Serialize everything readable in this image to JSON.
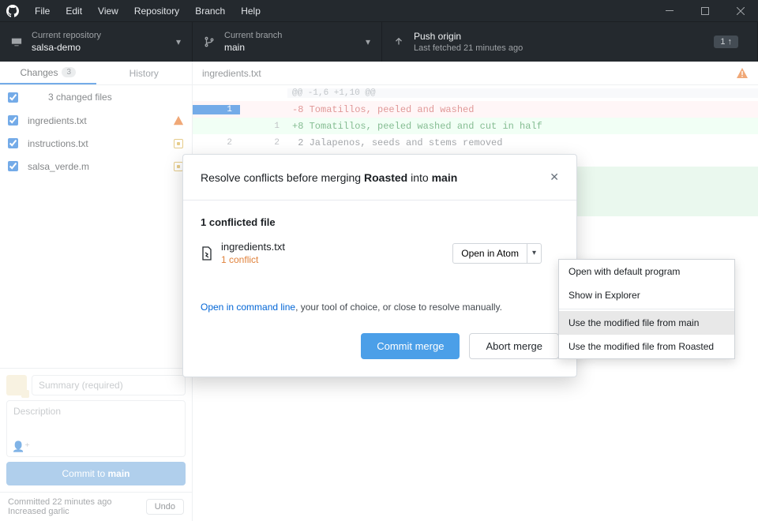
{
  "menubar": {
    "items": [
      "File",
      "Edit",
      "View",
      "Repository",
      "Branch",
      "Help"
    ]
  },
  "toolbar": {
    "repo": {
      "label": "Current repository",
      "value": "salsa-demo"
    },
    "branch": {
      "label": "Current branch",
      "value": "main"
    },
    "push": {
      "label": "Push origin",
      "value": "Last fetched 21 minutes ago",
      "badge": "1 ↑"
    }
  },
  "tabs": {
    "changes": {
      "label": "Changes",
      "count": "3"
    },
    "history": {
      "label": "History"
    }
  },
  "filelist": {
    "header": "3 changed files",
    "files": [
      {
        "name": "ingredients.txt",
        "status": "conflict"
      },
      {
        "name": "instructions.txt",
        "status": "modified"
      },
      {
        "name": "salsa_verde.m",
        "status": "modified"
      }
    ]
  },
  "commit_form": {
    "summary_placeholder": "Summary (required)",
    "description_placeholder": "Description",
    "button_prefix": "Commit to ",
    "button_branch": "main"
  },
  "statusbar": {
    "line1": "Committed 22 minutes ago",
    "line2": "Increased garlic",
    "undo": "Undo"
  },
  "diff": {
    "filename": "ingredients.txt",
    "hunk": "@@ -1,6 +1,10 @@",
    "lines": [
      {
        "old": "1",
        "new": "",
        "type": "removed",
        "text": "-8 Tomatillos, peeled and washed"
      },
      {
        "old": "",
        "new": "1",
        "type": "added",
        "text": "+8 Tomatillos, peeled washed and cut in half"
      },
      {
        "old": "2",
        "new": "2",
        "type": "context",
        "text": " 2 Jalapenos, seeds and stems removed"
      }
    ]
  },
  "modal": {
    "title_pre": "Resolve conflicts before merging ",
    "title_source": "Roasted",
    "title_mid": " into ",
    "title_target": "main",
    "conflicted_header": "1 conflicted file",
    "file": "ingredients.txt",
    "conflict_count": "1 conflict",
    "open_button": "Open in Atom",
    "cmdline_link": "Open in command line",
    "cmdline_rest": ", your tool of choice, or close to resolve manually.",
    "commit": "Commit merge",
    "abort": "Abort merge"
  },
  "dropdown": {
    "items": [
      "Open with default program",
      "Show in Explorer",
      "Use the modified file from main",
      "Use the modified file from Roasted"
    ]
  }
}
